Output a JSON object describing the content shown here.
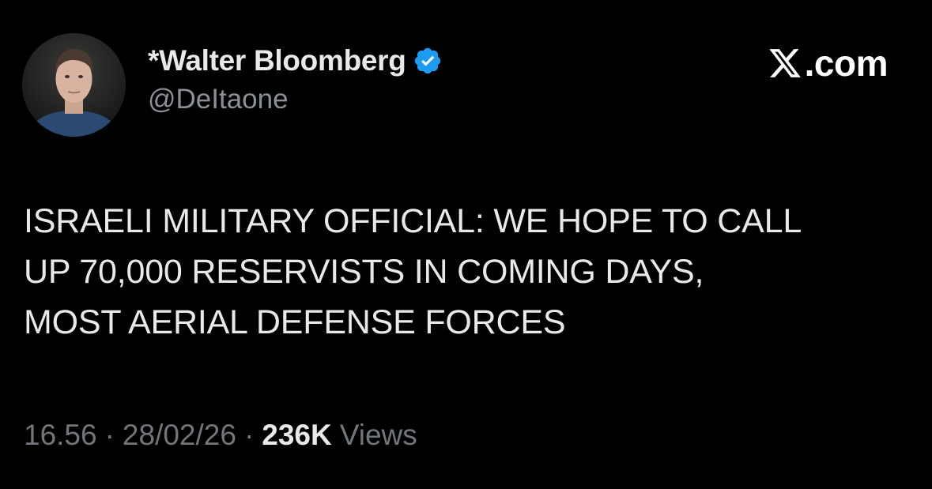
{
  "author": {
    "display_name": "*Walter Bloomberg",
    "handle": "@DeItaone",
    "verified": true,
    "verified_color": "#1d9bf0",
    "avatar_icon": "profile-photo"
  },
  "brand": {
    "text": ".com",
    "logo_icon": "x-logo-icon"
  },
  "tweet": {
    "lines": [
      "ISRAELI MILITARY OFFICIAL: WE HOPE TO CALL",
      "UP 70,000 RESERVISTS IN COMING DAYS,",
      "MOST AERIAL DEFENSE FORCES"
    ]
  },
  "meta": {
    "time": "16.56",
    "separator": "·",
    "date": "28/02/26",
    "views_count": "236K",
    "views_label": "Views"
  },
  "colors": {
    "background": "#000000",
    "primary_text": "#e7e9ea",
    "secondary_text": "#71767b",
    "accent": "#1d9bf0"
  }
}
